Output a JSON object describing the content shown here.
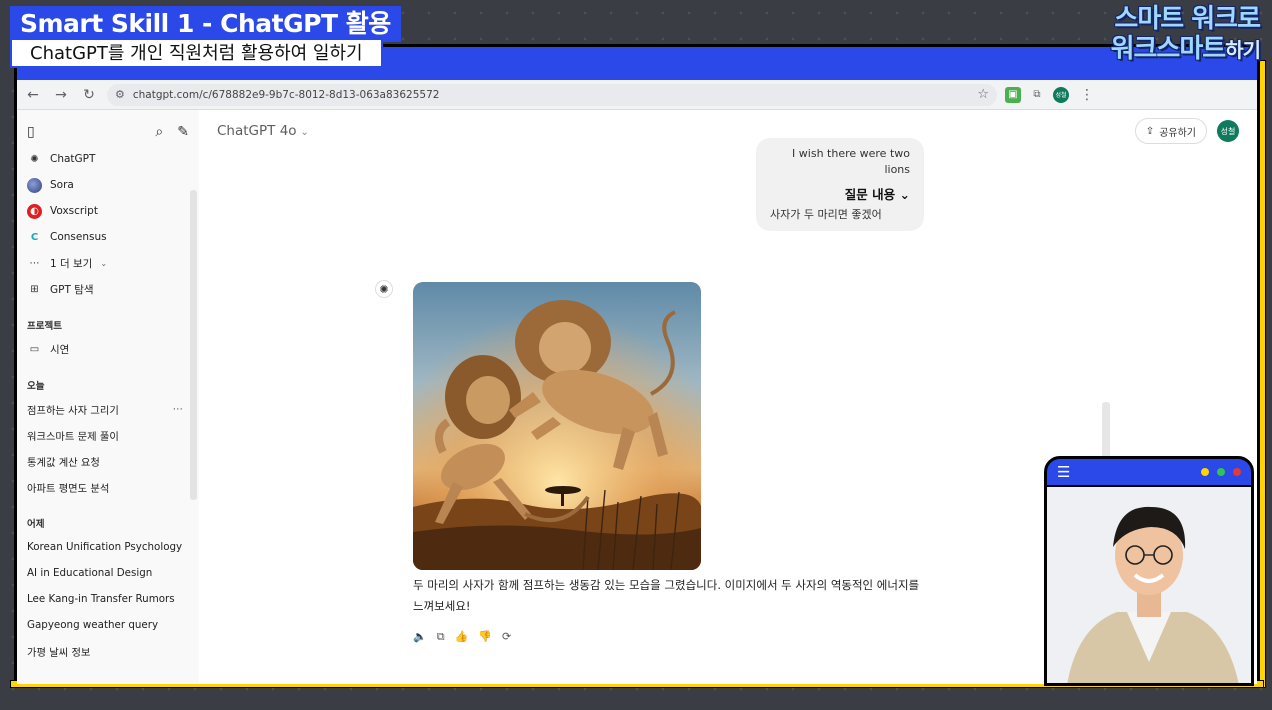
{
  "overlay": {
    "title": "Smart Skill 1 - ChatGPT 활용",
    "subtitle": "ChatGPT를 개인 직원처럼 활용하여 일하기",
    "logo_line1": "스마트 워크로",
    "logo_line2": "워크스마트",
    "logo_line2_suffix": "하기"
  },
  "browser": {
    "url": "chatgpt.com/c/678882e9-9b7c-8012-8d13-063a83625572",
    "profile_badge": "성철"
  },
  "sidebar": {
    "items": [
      {
        "label": "ChatGPT",
        "icon": "openai-icon"
      },
      {
        "label": "Sora",
        "icon": "sora-icon"
      },
      {
        "label": "Voxscript",
        "icon": "voxscript-icon"
      },
      {
        "label": "Consensus",
        "icon": "consensus-icon"
      },
      {
        "label": "1 더 보기",
        "icon": "more-dots-icon"
      },
      {
        "label": "GPT 탐색",
        "icon": "grid-icon"
      }
    ],
    "projects_label": "프로젝트",
    "project_item": "시연",
    "today_label": "오늘",
    "today_chats": [
      "점프하는 사자 그리기",
      "워크스마트 문제 풀이",
      "통계값 계산 요청",
      "아파트 평면도 분석"
    ],
    "yesterday_label": "어제",
    "yesterday_chats": [
      "Korean Unification Psychology",
      "AI in Educational Design",
      "Lee Kang-in Transfer Rumors",
      "Gapyeong weather query",
      "가평 날씨 정보"
    ]
  },
  "main": {
    "model": "ChatGPT 4o",
    "share_label": "공유하기",
    "avatar_label": "성철",
    "user_message": "I wish there were two lions",
    "toggle_label": "질문 내용",
    "translation": "사자가 두 마리면 좋겠어",
    "response_text": "두 마리의 사자가 함께 점프하는 생동감 있는 모습을 그렸습니다. 이미지에서 두 사자의 역동적인 에너지를 느껴보세요!"
  },
  "colors": {
    "brand_blue": "#2b49e8",
    "accent_yellow": "#ffd400",
    "chatgpt_green": "#0f7a5c"
  }
}
